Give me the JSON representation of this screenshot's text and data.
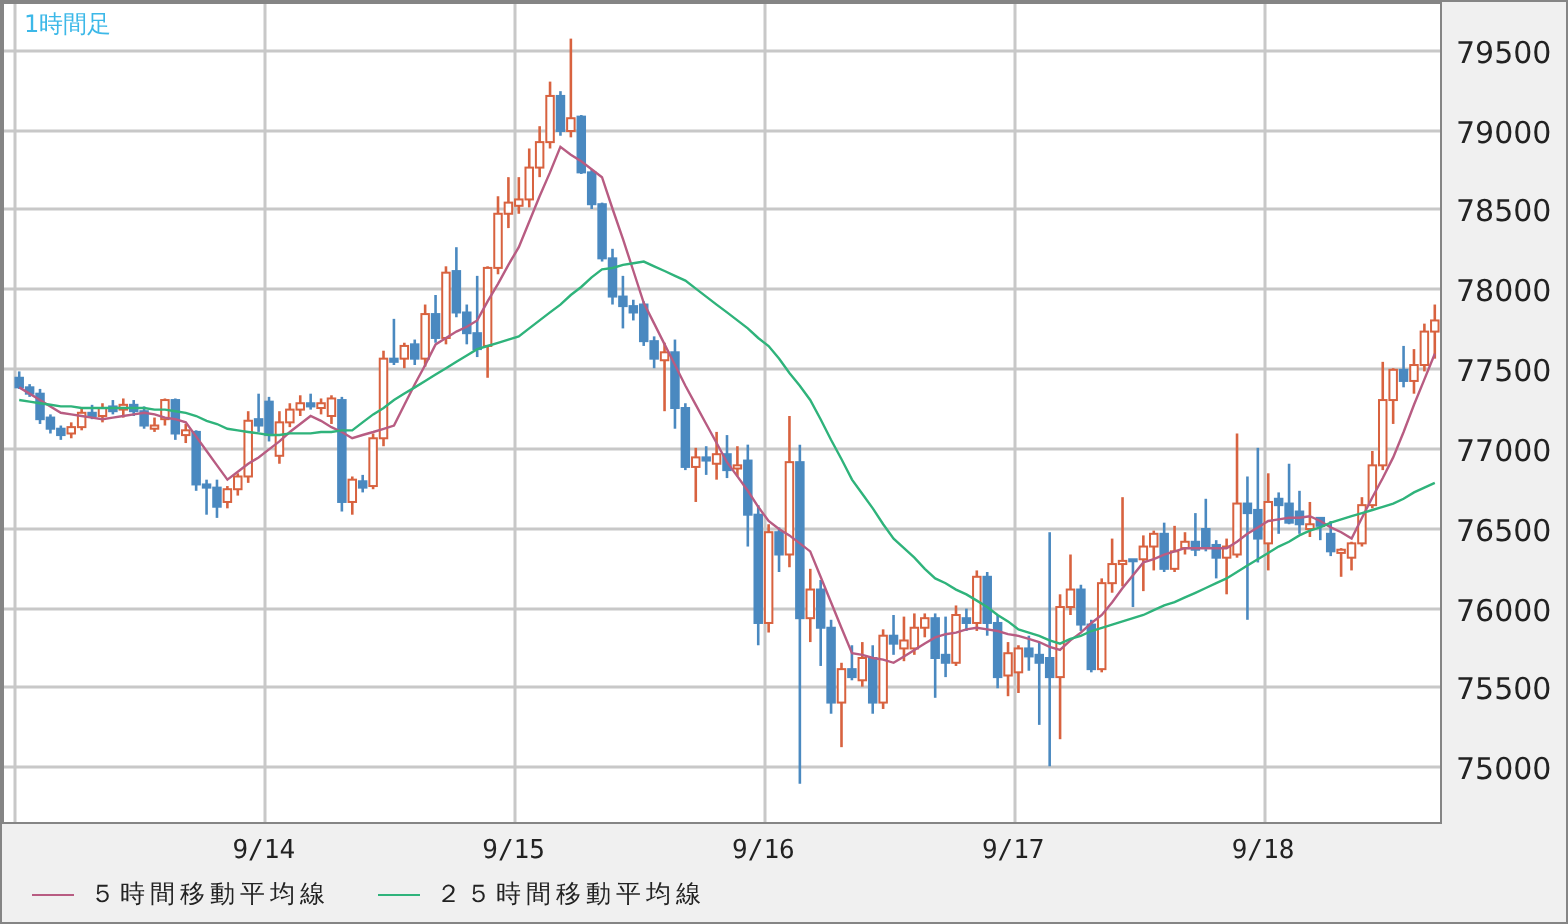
{
  "chart": {
    "chart_data": {
      "type": "candlestick",
      "title": "1時間足",
      "categories": [
        null,
        null,
        null,
        null,
        null,
        null,
        null,
        null,
        null,
        null,
        null,
        null,
        null,
        null,
        null,
        null,
        null,
        null,
        null,
        null,
        null,
        null,
        null,
        null,
        "9/14",
        null,
        null,
        null,
        null,
        null,
        null,
        null,
        null,
        null,
        null,
        null,
        null,
        null,
        null,
        null,
        null,
        null,
        null,
        null,
        null,
        null,
        null,
        null,
        "9/15",
        null,
        null,
        null,
        null,
        null,
        null,
        null,
        null,
        null,
        null,
        null,
        null,
        null,
        null,
        null,
        null,
        null,
        null,
        null,
        null,
        null,
        null,
        null,
        "9/16",
        null,
        null,
        null,
        null,
        null,
        null,
        null,
        null,
        null,
        null,
        null,
        null,
        null,
        null,
        null,
        null,
        null,
        null,
        null,
        null,
        null,
        null,
        null,
        "9/17",
        null,
        null,
        null,
        null,
        null,
        null,
        null,
        null,
        null,
        null,
        null,
        null,
        null,
        null,
        null,
        null,
        null,
        null,
        null,
        null,
        null,
        null,
        null,
        "9/18",
        null,
        null,
        null,
        null,
        null,
        null,
        null,
        null,
        null,
        null,
        null,
        null,
        null,
        null,
        null,
        null
      ],
      "series": [
        {
          "name": "５時間移動平均線",
          "type": "line",
          "color": "#b85c82",
          "values": [
            77380,
            77340,
            77300,
            77260,
            77220,
            77210,
            77200,
            77190,
            77180,
            77190,
            77200,
            77210,
            77220,
            77210,
            77190,
            77180,
            77160,
            77070,
            76980,
            76890,
            76800,
            76850,
            76900,
            76940,
            76990,
            77040,
            77100,
            77150,
            77200,
            77170,
            77130,
            77100,
            77060,
            77080,
            77100,
            77120,
            77140,
            77270,
            77400,
            77520,
            77650,
            77690,
            77730,
            77760,
            77800,
            77920,
            78030,
            78150,
            78260,
            78420,
            78580,
            78730,
            78890,
            78840,
            78800,
            78750,
            78700,
            78500,
            78310,
            78110,
            77910,
            77780,
            77650,
            77520,
            77390,
            77270,
            77150,
            77030,
            76910,
            76820,
            76730,
            76630,
            76540,
            76490,
            76450,
            76400,
            76350,
            76190,
            76030,
            75870,
            75710,
            75700,
            75680,
            75670,
            75650,
            75690,
            75730,
            75770,
            75810,
            75830,
            75840,
            75860,
            75870,
            75860,
            75850,
            75830,
            75820,
            75800,
            75780,
            75750,
            75730,
            75790,
            75840,
            75900,
            75950,
            76030,
            76120,
            76200,
            76280,
            76300,
            76330,
            76350,
            76370,
            76370,
            76370,
            76370,
            76370,
            76410,
            76460,
            76500,
            76540,
            76550,
            76560,
            76560,
            76570,
            76540,
            76500,
            76470,
            76430,
            76560,
            76690,
            76810,
            76940,
            77100,
            77270,
            77430,
            77590
          ]
        },
        {
          "name": "２５時間移動平均線",
          "type": "line",
          "color": "#2fb37b",
          "values": [
            77300,
            77290,
            77280,
            77270,
            77260,
            77260,
            77250,
            77250,
            77250,
            77250,
            77250,
            77250,
            77250,
            77240,
            77240,
            77230,
            77220,
            77200,
            77170,
            77150,
            77120,
            77110,
            77100,
            77090,
            77080,
            77080,
            77090,
            77090,
            77090,
            77100,
            77100,
            77110,
            77110,
            77160,
            77210,
            77250,
            77300,
            77340,
            77380,
            77420,
            77460,
            77500,
            77540,
            77580,
            77620,
            77640,
            77660,
            77680,
            77700,
            77750,
            77800,
            77850,
            77900,
            77960,
            78010,
            78070,
            78120,
            78130,
            78150,
            78160,
            78170,
            78140,
            78110,
            78080,
            78050,
            78000,
            77950,
            77900,
            77850,
            77800,
            77750,
            77690,
            77640,
            77560,
            77470,
            77390,
            77300,
            77180,
            77050,
            76930,
            76800,
            76710,
            76620,
            76520,
            76430,
            76370,
            76310,
            76240,
            76180,
            76150,
            76110,
            76080,
            76040,
            76000,
            75950,
            75910,
            75860,
            75840,
            75820,
            75790,
            75770,
            75800,
            75820,
            75850,
            75870,
            75890,
            75910,
            75930,
            75950,
            75980,
            76010,
            76030,
            76060,
            76090,
            76120,
            76150,
            76180,
            76220,
            76260,
            76300,
            76340,
            76380,
            76410,
            76450,
            76480,
            76500,
            76530,
            76550,
            76570,
            76590,
            76610,
            76630,
            76650,
            76680,
            76720,
            76750,
            76780
          ]
        }
      ],
      "ylim": [
        74650,
        79800
      ],
      "yticks": [
        75000,
        75500,
        76000,
        76500,
        77000,
        77500,
        78000,
        78500,
        79000,
        79500
      ],
      "grid": true,
      "ohlc": [
        [
          77440,
          77480,
          77370,
          77380
        ],
        [
          77380,
          77400,
          77320,
          77340
        ],
        [
          77340,
          77370,
          77150,
          77180
        ],
        [
          77190,
          77210,
          77090,
          77120
        ],
        [
          77120,
          77140,
          77050,
          77080
        ],
        [
          77090,
          77160,
          77060,
          77130
        ],
        [
          77130,
          77250,
          77110,
          77220
        ],
        [
          77220,
          77270,
          77180,
          77200
        ],
        [
          77200,
          77280,
          77160,
          77250
        ],
        [
          77260,
          77300,
          77210,
          77230
        ],
        [
          77240,
          77310,
          77190,
          77270
        ],
        [
          77270,
          77300,
          77200,
          77230
        ],
        [
          77230,
          77260,
          77120,
          77140
        ],
        [
          77120,
          77190,
          77100,
          77140
        ],
        [
          77180,
          77310,
          77140,
          77300
        ],
        [
          77300,
          77310,
          77050,
          77090
        ],
        [
          77080,
          77150,
          77030,
          77110
        ],
        [
          77100,
          77110,
          76730,
          76770
        ],
        [
          76770,
          76800,
          76580,
          76750
        ],
        [
          76750,
          76800,
          76560,
          76630
        ],
        [
          76660,
          76760,
          76620,
          76740
        ],
        [
          76740,
          76840,
          76700,
          76820
        ],
        [
          76820,
          77230,
          76780,
          77170
        ],
        [
          77180,
          77340,
          77100,
          77140
        ],
        [
          77290,
          77320,
          77040,
          77080
        ],
        [
          76950,
          77230,
          76900,
          77160
        ],
        [
          77160,
          77280,
          77130,
          77240
        ],
        [
          77240,
          77330,
          77200,
          77280
        ],
        [
          77280,
          77340,
          77240,
          77260
        ],
        [
          77250,
          77310,
          77210,
          77280
        ],
        [
          77200,
          77330,
          77150,
          77310
        ],
        [
          77300,
          77320,
          76600,
          76660
        ],
        [
          76660,
          76820,
          76580,
          76800
        ],
        [
          76790,
          76830,
          76720,
          76750
        ],
        [
          76760,
          77090,
          76740,
          77060
        ],
        [
          77060,
          77610,
          77010,
          77560
        ],
        [
          77560,
          77810,
          77520,
          77540
        ],
        [
          77560,
          77660,
          77500,
          77640
        ],
        [
          77650,
          77680,
          77520,
          77560
        ],
        [
          77560,
          77900,
          77510,
          77840
        ],
        [
          77840,
          77960,
          77660,
          77690
        ],
        [
          77690,
          78140,
          77650,
          78100
        ],
        [
          78110,
          78260,
          77820,
          77850
        ],
        [
          77850,
          77900,
          77650,
          77720
        ],
        [
          77720,
          78080,
          77570,
          77620
        ],
        [
          77640,
          78140,
          77440,
          78130
        ],
        [
          78130,
          78580,
          78090,
          78470
        ],
        [
          78470,
          78700,
          78380,
          78540
        ],
        [
          78520,
          78700,
          78470,
          78560
        ],
        [
          78560,
          78880,
          78510,
          78760
        ],
        [
          78760,
          79020,
          78700,
          78920
        ],
        [
          78920,
          79300,
          78880,
          79210
        ],
        [
          79210,
          79240,
          78960,
          78990
        ],
        [
          78990,
          79570,
          78950,
          79070
        ],
        [
          79080,
          79090,
          78720,
          78730
        ],
        [
          78730,
          78750,
          78500,
          78530
        ],
        [
          78530,
          78540,
          78170,
          78190
        ],
        [
          78190,
          78250,
          77900,
          77950
        ],
        [
          77950,
          78080,
          77750,
          77890
        ],
        [
          77890,
          77930,
          77800,
          77850
        ],
        [
          77900,
          77920,
          77640,
          77670
        ],
        [
          77670,
          77700,
          77500,
          77560
        ],
        [
          77550,
          77660,
          77230,
          77600
        ],
        [
          77600,
          77680,
          77120,
          77250
        ],
        [
          77250,
          77280,
          76860,
          76880
        ],
        [
          76880,
          77000,
          76660,
          76940
        ],
        [
          76940,
          77010,
          76830,
          76920
        ],
        [
          76900,
          77100,
          76800,
          76960
        ],
        [
          76960,
          77080,
          76810,
          76860
        ],
        [
          76870,
          77010,
          76820,
          76890
        ],
        [
          76920,
          77020,
          76380,
          76580
        ],
        [
          76580,
          76640,
          75760,
          75900
        ],
        [
          75900,
          76520,
          75840,
          76470
        ],
        [
          76470,
          76500,
          76220,
          76330
        ],
        [
          76330,
          77200,
          76250,
          76910
        ],
        [
          76910,
          77020,
          74890,
          75930
        ],
        [
          75930,
          76240,
          75780,
          76110
        ],
        [
          76110,
          76170,
          75630,
          75870
        ],
        [
          75870,
          75920,
          75330,
          75400
        ],
        [
          75400,
          75650,
          75120,
          75610
        ],
        [
          75610,
          75760,
          75540,
          75560
        ],
        [
          75540,
          75780,
          75500,
          75680
        ],
        [
          75680,
          75760,
          75330,
          75400
        ],
        [
          75400,
          75860,
          75360,
          75820
        ],
        [
          75820,
          75950,
          75700,
          75770
        ],
        [
          75740,
          75940,
          75660,
          75790
        ],
        [
          75740,
          75960,
          75700,
          75870
        ],
        [
          75870,
          75960,
          75810,
          75930
        ],
        [
          75930,
          75960,
          75430,
          75680
        ],
        [
          75700,
          75940,
          75560,
          75650
        ],
        [
          75650,
          76010,
          75630,
          75950
        ],
        [
          75930,
          75990,
          75850,
          75900
        ],
        [
          75900,
          76230,
          75850,
          76190
        ],
        [
          76190,
          76220,
          75820,
          75900
        ],
        [
          75900,
          75950,
          75490,
          75560
        ],
        [
          75570,
          75780,
          75440,
          75710
        ],
        [
          75590,
          75760,
          75460,
          75740
        ],
        [
          75740,
          75820,
          75600,
          75690
        ],
        [
          75700,
          75780,
          75260,
          75650
        ],
        [
          75680,
          76470,
          75000,
          75560
        ],
        [
          75560,
          76080,
          75170,
          76000
        ],
        [
          76000,
          76330,
          75950,
          76110
        ],
        [
          76110,
          76140,
          75850,
          75890
        ],
        [
          75890,
          75920,
          75590,
          75610
        ],
        [
          75610,
          76180,
          75590,
          76150
        ],
        [
          76150,
          76430,
          76090,
          76270
        ],
        [
          76270,
          76690,
          76130,
          76290
        ],
        [
          76300,
          76300,
          76000,
          76290
        ],
        [
          76300,
          76450,
          76100,
          76380
        ],
        [
          76380,
          76480,
          76230,
          76460
        ],
        [
          76460,
          76530,
          76220,
          76240
        ],
        [
          76240,
          76510,
          76220,
          76350
        ],
        [
          76370,
          76470,
          76330,
          76410
        ],
        [
          76410,
          76590,
          76320,
          76360
        ],
        [
          76490,
          76680,
          76350,
          76380
        ],
        [
          76390,
          76420,
          76180,
          76310
        ],
        [
          76310,
          76430,
          76080,
          76380
        ],
        [
          76330,
          77090,
          76310,
          76650
        ],
        [
          76650,
          76820,
          75920,
          76590
        ],
        [
          76610,
          77000,
          76280,
          76430
        ],
        [
          76400,
          76840,
          76230,
          76660
        ],
        [
          76680,
          76720,
          76460,
          76640
        ],
        [
          76650,
          76900,
          76520,
          76530
        ],
        [
          76600,
          76730,
          76460,
          76520
        ],
        [
          76490,
          76660,
          76440,
          76520
        ],
        [
          76560,
          76560,
          76420,
          76510
        ],
        [
          76460,
          76540,
          76320,
          76350
        ],
        [
          76340,
          76370,
          76190,
          76360
        ],
        [
          76310,
          76410,
          76230,
          76400
        ],
        [
          76400,
          76690,
          76380,
          76640
        ],
        [
          76640,
          76980,
          76620,
          76890
        ],
        [
          76890,
          77540,
          76860,
          77300
        ],
        [
          77300,
          77500,
          77150,
          77490
        ],
        [
          77490,
          77640,
          77380,
          77420
        ],
        [
          77420,
          77620,
          77340,
          77520
        ],
        [
          77520,
          77780,
          77480,
          77730
        ],
        [
          77730,
          77900,
          77560,
          77800
        ]
      ]
    }
  }
}
